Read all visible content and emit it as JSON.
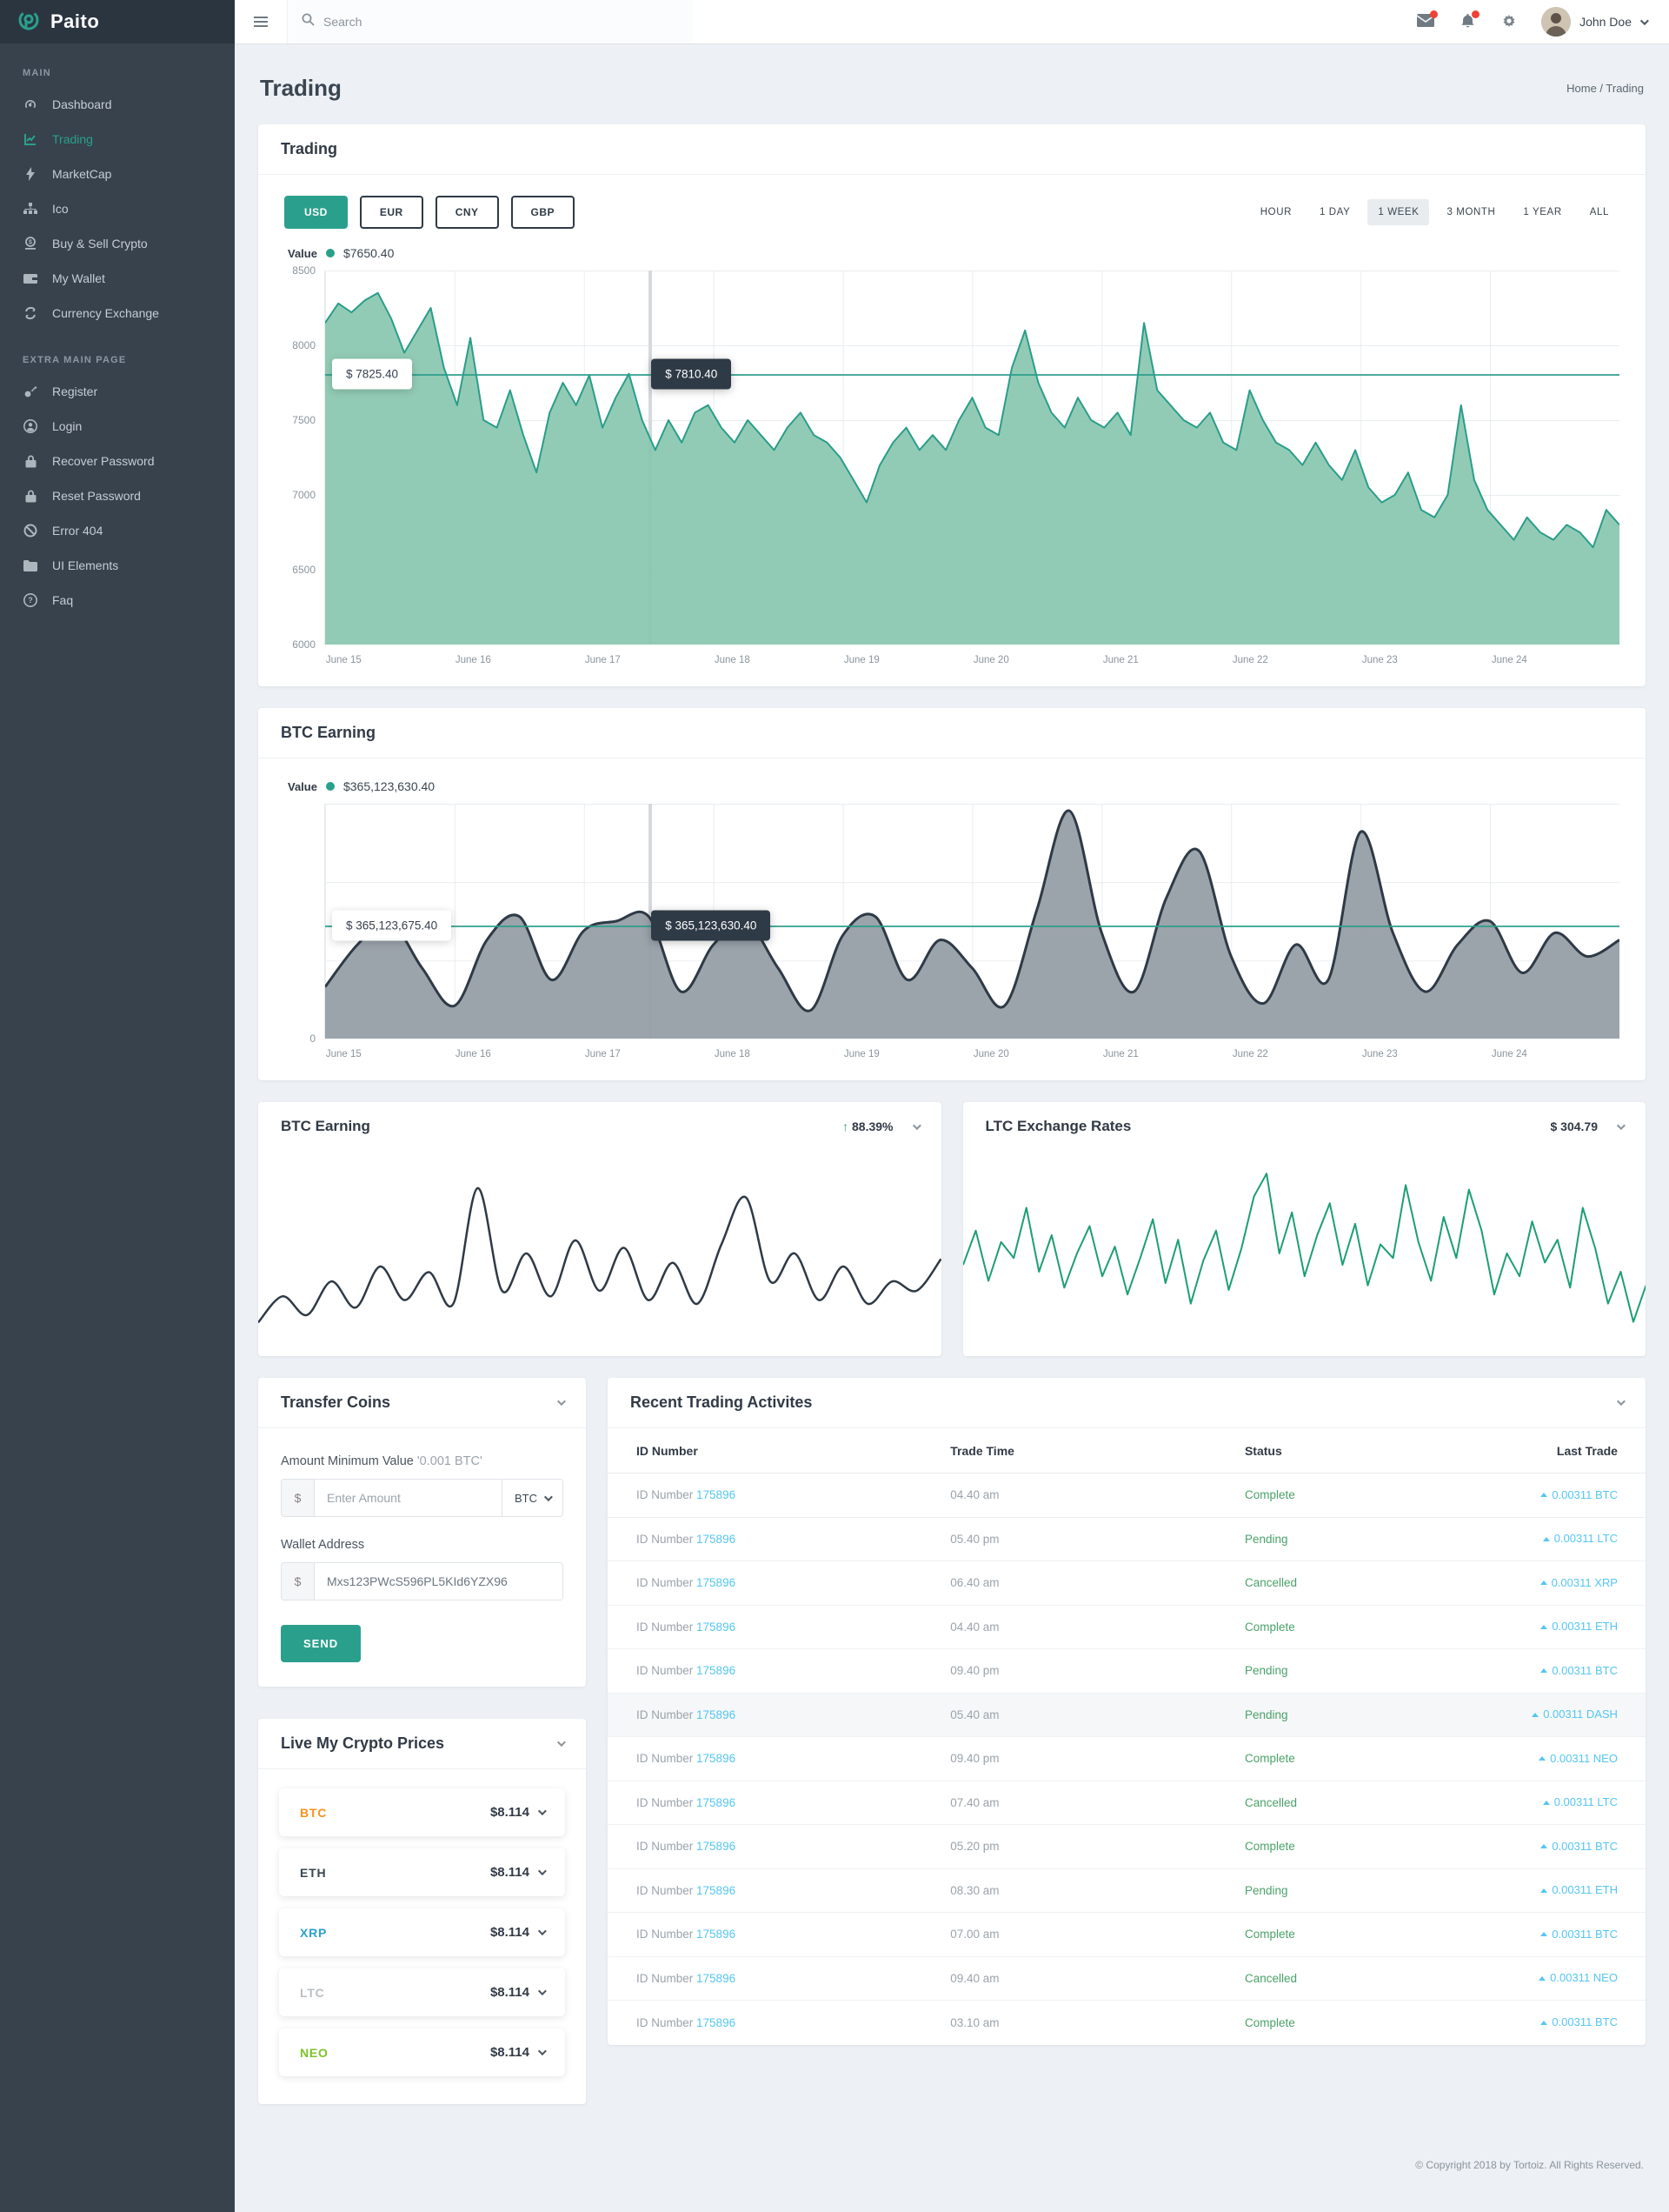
{
  "brand": {
    "name": "Paito"
  },
  "topbar": {
    "search_placeholder": "Search",
    "user_name": "John Doe"
  },
  "sidebar": {
    "section_main": "MAIN",
    "section_extra": "EXTRA MAIN PAGE",
    "main_items": [
      {
        "label": "Dashboard",
        "icon": "gauge-icon"
      },
      {
        "label": "Trading",
        "icon": "chart-line-icon",
        "active": true
      },
      {
        "label": "MarketCap",
        "icon": "bolt-icon"
      },
      {
        "label": "Ico",
        "icon": "sitemap-icon"
      },
      {
        "label": "Buy & Sell Crypto",
        "icon": "coin-icon"
      },
      {
        "label": "My Wallet",
        "icon": "wallet-icon"
      },
      {
        "label": "Currency Exchange",
        "icon": "exchange-icon"
      }
    ],
    "extra_items": [
      {
        "label": "Register",
        "icon": "key-icon"
      },
      {
        "label": "Login",
        "icon": "user-icon"
      },
      {
        "label": "Recover Password",
        "icon": "lock-icon"
      },
      {
        "label": "Reset Password",
        "icon": "lock-icon"
      },
      {
        "label": "Error 404",
        "icon": "ban-icon"
      },
      {
        "label": "UI Elements",
        "icon": "folder-icon"
      },
      {
        "label": "Faq",
        "icon": "question-icon"
      }
    ]
  },
  "page": {
    "title": "Trading",
    "breadcrumb": "Home / Trading"
  },
  "trading_card": {
    "title": "Trading",
    "currencies": [
      "USD",
      "EUR",
      "CNY",
      "GBP"
    ],
    "active_currency": "USD",
    "ranges": [
      "HOUR",
      "1 DAY",
      "1 WEEK",
      "3 MONTH",
      "1 YEAR",
      "ALL"
    ],
    "active_range": "1 WEEK",
    "legend_label": "Value",
    "legend_value": "$7650.40",
    "tooltip_left": "$ 7825.40",
    "tooltip_cross": "$ 7810.40"
  },
  "btc_card": {
    "title": "BTC Earning",
    "legend_label": "Value",
    "legend_value": "$365,123,630.40",
    "tooltip_left": "$ 365,123,675.40",
    "tooltip_cross": "$ 365,123,630.40",
    "y_zero": "0"
  },
  "mini_cards": [
    {
      "title": "BTC Earning",
      "delta": "88.39%",
      "delta_direction": "up"
    },
    {
      "title": "LTC Exchange Rates",
      "value": "$ 304.79"
    }
  ],
  "transfer": {
    "title": "Transfer Coins",
    "amount_label": "Amount Minimum Value",
    "amount_hint": "'0.001 BTC'",
    "prefix": "$",
    "amount_placeholder": "Enter Amount",
    "coin": "BTC",
    "wallet_label": "Wallet Address",
    "wallet_value": "Mxs123PWcS596PL5KId6YZX96",
    "send_label": "SEND"
  },
  "live_prices": {
    "title": "Live My Crypto Prices",
    "items": [
      {
        "symbol": "BTC",
        "price": "$8.114",
        "color": "#f7931a"
      },
      {
        "symbol": "ETH",
        "price": "$8.114",
        "color": "#37474f"
      },
      {
        "symbol": "XRP",
        "price": "$8.114",
        "color": "#2f9fd0"
      },
      {
        "symbol": "LTC",
        "price": "$8.114",
        "color": "#b9bfc4"
      },
      {
        "symbol": "NEO",
        "price": "$8.114",
        "color": "#7cc527"
      }
    ]
  },
  "activities": {
    "title": "Recent Trading Activites",
    "id_prefix": "ID Number",
    "columns": [
      "ID Number",
      "Trade Time",
      "Status",
      "Last Trade"
    ],
    "rows": [
      {
        "id": "175896",
        "time": "04.40 am",
        "status": "Complete",
        "trade": "0.00311 BTC"
      },
      {
        "id": "175896",
        "time": "05.40 pm",
        "status": "Pending",
        "trade": "0.00311 LTC"
      },
      {
        "id": "175896",
        "time": "06.40 am",
        "status": "Cancelled",
        "trade": "0.00311 XRP"
      },
      {
        "id": "175896",
        "time": "04.40 am",
        "status": "Complete",
        "trade": "0.00311 ETH"
      },
      {
        "id": "175896",
        "time": "09.40 pm",
        "status": "Pending",
        "trade": "0.00311 BTC"
      },
      {
        "id": "175896",
        "time": "05.40 am",
        "status": "Pending",
        "trade": "0.00311 DASH"
      },
      {
        "id": "175896",
        "time": "09.40 pm",
        "status": "Complete",
        "trade": "0.00311 NEO"
      },
      {
        "id": "175896",
        "time": "07.40 am",
        "status": "Cancelled",
        "trade": "0.00311 LTC"
      },
      {
        "id": "175896",
        "time": "05.20 pm",
        "status": "Complete",
        "trade": "0.00311 BTC"
      },
      {
        "id": "175896",
        "time": "08.30 am",
        "status": "Pending",
        "trade": "0.00311 ETH"
      },
      {
        "id": "175896",
        "time": "07.00 am",
        "status": "Complete",
        "trade": "0.00311 BTC"
      },
      {
        "id": "175896",
        "time": "09.40 am",
        "status": "Cancelled",
        "trade": "0.00311 NEO"
      },
      {
        "id": "175896",
        "time": "03.10 am",
        "status": "Complete",
        "trade": "0.00311 BTC"
      }
    ]
  },
  "footer": {
    "copyright": "© Copyright 2018 by Tortoiz. All Rights Reserved."
  },
  "colors": {
    "accent_teal": "#2aa08c",
    "sidebar_bg": "#37424d",
    "dark_navy": "#2e3a46",
    "status_green": "#4aa168",
    "link_blue": "#55c6f0",
    "alert_red": "#ef4136"
  },
  "chart_data": [
    {
      "name": "trading-main",
      "type": "area",
      "smooth": false,
      "title": "Trading",
      "legend": "Value $7650.40",
      "stroke": "#2a9d8a",
      "stroke_width": 2,
      "fill": "rgba(134,197,173,0.9)",
      "ymin": 6000,
      "ymax": 8500,
      "y_ticks": [
        "8500",
        "8000",
        "7500",
        "7000",
        "6500",
        "6000"
      ],
      "x_labels": [
        "June 15",
        "June 16",
        "June 17",
        "June 18",
        "June 19",
        "June 20",
        "June 21",
        "June 22",
        "June 23",
        "June 24"
      ],
      "ref_value": 7810.4,
      "ref_start_value": 7825.4,
      "crosshair_x_pct": 25,
      "grid": true,
      "values": [
        8150,
        8280,
        8220,
        8300,
        8350,
        8180,
        7950,
        8100,
        8250,
        7850,
        7600,
        8050,
        7500,
        7450,
        7700,
        7400,
        7150,
        7550,
        7750,
        7600,
        7800,
        7450,
        7650,
        7810,
        7500,
        7300,
        7500,
        7350,
        7550,
        7600,
        7450,
        7350,
        7500,
        7400,
        7300,
        7450,
        7550,
        7400,
        7350,
        7250,
        7100,
        6950,
        7200,
        7350,
        7450,
        7300,
        7400,
        7300,
        7500,
        7650,
        7450,
        7400,
        7850,
        8100,
        7750,
        7550,
        7450,
        7650,
        7500,
        7450,
        7550,
        7400,
        8150,
        7700,
        7600,
        7500,
        7450,
        7550,
        7350,
        7300,
        7700,
        7500,
        7350,
        7300,
        7200,
        7350,
        7200,
        7100,
        7300,
        7050,
        6950,
        7000,
        7150,
        6900,
        6850,
        7000,
        7600,
        7100,
        6900,
        6800,
        6700,
        6850,
        6750,
        6700,
        6800,
        6750,
        6650,
        6900,
        6800
      ]
    },
    {
      "name": "btc-earning-wave",
      "type": "area",
      "smooth": true,
      "title": "BTC Earning",
      "legend": "Value $365,123,630.40",
      "stroke": "#2e3a46",
      "stroke_width": 3,
      "fill": "rgba(150,158,166,0.95)",
      "ymin": 0,
      "ymax": 100,
      "y_ticks": [
        "0"
      ],
      "x_labels": [
        "June 15",
        "June 16",
        "June 17",
        "June 18",
        "June 19",
        "June 20",
        "June 21",
        "June 22",
        "June 23",
        "June 24"
      ],
      "ref_value": 52,
      "crosshair_x_pct": 25,
      "grid": true,
      "values": [
        22,
        40,
        50,
        30,
        14,
        42,
        52,
        25,
        46,
        50,
        52,
        20,
        40,
        50,
        30,
        12,
        44,
        52,
        25,
        42,
        30,
        14,
        55,
        97,
        45,
        20,
        60,
        80,
        35,
        15,
        40,
        25,
        88,
        45,
        20,
        40,
        50,
        28,
        45,
        35,
        42
      ]
    },
    {
      "name": "btc-earning-mini",
      "type": "line",
      "smooth": true,
      "title": "BTC Earning 88.39%",
      "stroke": "#2e3a46",
      "stroke_width": 2.5,
      "ymin": 0,
      "ymax": 110,
      "grid": false,
      "values": [
        18,
        32,
        22,
        40,
        26,
        48,
        30,
        45,
        28,
        90,
        35,
        55,
        32,
        62,
        35,
        58,
        30,
        50,
        28,
        60,
        85,
        40,
        55,
        30,
        48,
        28,
        40,
        35,
        52
      ]
    },
    {
      "name": "ltc-rates",
      "type": "line",
      "smooth": false,
      "title": "LTC Exchange Rates $ 304.79",
      "stroke": "#1d9e74",
      "stroke_width": 2,
      "ymin": 15,
      "ymax": 105,
      "grid": false,
      "values": [
        55,
        70,
        48,
        65,
        58,
        80,
        52,
        68,
        45,
        60,
        72,
        50,
        63,
        42,
        58,
        75,
        47,
        66,
        38,
        57,
        70,
        44,
        62,
        85,
        95,
        60,
        78,
        50,
        68,
        82,
        55,
        73,
        46,
        64,
        58,
        90,
        65,
        48,
        76,
        58,
        88,
        70,
        42,
        60,
        50,
        74,
        56,
        66,
        45,
        80,
        62,
        38,
        52,
        30,
        46
      ]
    }
  ]
}
